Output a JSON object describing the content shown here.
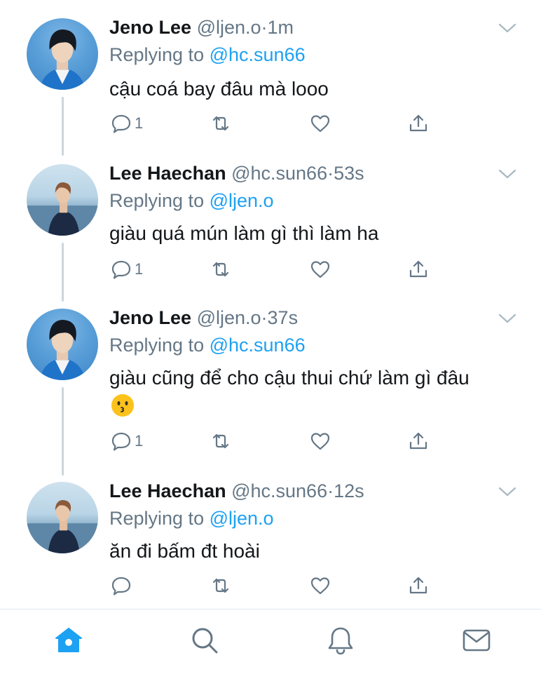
{
  "colors": {
    "accent": "#1da1f2",
    "secondary_text": "#657786",
    "thread_line": "#ccd6dd"
  },
  "tweets": [
    {
      "avatar": "jeno-avatar",
      "name": "Jeno Lee",
      "handle": "@ljen.o",
      "dot": "·",
      "time": "1m",
      "replying_prefix": "Replying to",
      "replying_to": "@hc.sun66",
      "text": "cậu coá bay đâu mà looo",
      "reply_count": "1"
    },
    {
      "avatar": "haechan-avatar",
      "name": "Lee Haechan",
      "handle": "@hc.sun66",
      "dot": "·",
      "time": "53s",
      "replying_prefix": "Replying to",
      "replying_to": "@ljen.o",
      "text": "giàu quá mún làm gì thì làm ha",
      "reply_count": "1"
    },
    {
      "avatar": "jeno-avatar",
      "name": "Jeno Lee",
      "handle": "@ljen.o",
      "dot": "·",
      "time": "37s",
      "replying_prefix": "Replying to",
      "replying_to": "@hc.sun66",
      "text": "giàu cũng để cho cậu thui chứ làm gì đâu",
      "emoji": "kissing-face-emoji",
      "reply_count": "1"
    },
    {
      "avatar": "haechan-avatar",
      "name": "Lee Haechan",
      "handle": "@hc.sun66",
      "dot": "·",
      "time": "12s",
      "replying_prefix": "Replying to",
      "replying_to": "@ljen.o",
      "text": "ăn đi bấm đt hoài",
      "reply_count": ""
    }
  ],
  "tabbar": {
    "items": [
      "home-icon",
      "search-icon",
      "notifications-icon",
      "messages-icon"
    ],
    "active": "home-icon"
  }
}
